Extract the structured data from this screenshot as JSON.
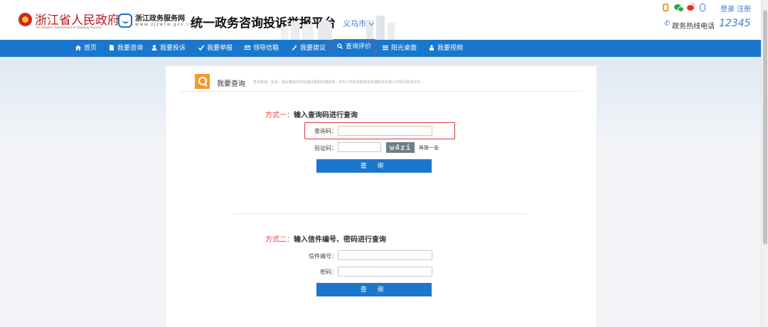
{
  "header": {
    "gov_title": "浙江省人民政府",
    "gov_subtitle": "The People's Government of Zhejiang Province",
    "service_name": "浙江政务服务网",
    "service_url": "www.zjzwfw.gov.cn",
    "platform_title": "统一政务咨询投诉举报平台",
    "city": "义乌市",
    "login": "登录",
    "register": "注册",
    "hotline_label": "政务热线电话",
    "hotline_number": "12345"
  },
  "nav": {
    "items": [
      {
        "label": "首页",
        "icon": "home-icon"
      },
      {
        "label": "我要咨询",
        "icon": "document-icon"
      },
      {
        "label": "我要投诉",
        "icon": "user-icon"
      },
      {
        "label": "我要举报",
        "icon": "check-icon"
      },
      {
        "label": "领导信箱",
        "icon": "mail-icon"
      },
      {
        "label": "我要建议",
        "icon": "wand-icon"
      },
      {
        "label": "查询评价",
        "icon": "search-icon"
      },
      {
        "label": "阳光桌面",
        "icon": "list-icon"
      },
      {
        "label": "我要视频",
        "icon": "video-icon"
      }
    ],
    "active": "查询评价"
  },
  "card": {
    "title": "我要查询",
    "description": "查询咨询、投诉、建议等信件的处理过程和办理结果，并对工作机构和有权处理机关办理工作情况作出评价。"
  },
  "method1": {
    "label": "方式一：",
    "text": "输入查询码进行查询",
    "code_label": "查询码：",
    "captcha_label": "验证码：",
    "captcha_text": "w4zi",
    "refresh_label": "再换一张",
    "button": "查 询"
  },
  "method2": {
    "label": "方式二：",
    "text": "输入信件编号、密码进行查询",
    "letter_label": "信件编号：",
    "password_label": "密码：",
    "button": "查 询"
  },
  "colors": {
    "nav_blue": "#1a77cb",
    "highlight_red": "#d93a3a",
    "accent_orange": "#f39a2b"
  }
}
